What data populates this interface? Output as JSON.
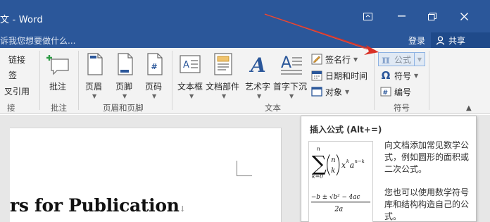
{
  "window": {
    "title": "文 - Word",
    "controls": {
      "ribbon_options": "ribbon-display-options",
      "minimize": "minimize",
      "restore": "restore",
      "close": "close"
    }
  },
  "tellme": {
    "placeholder": "诉我您想要做什么..."
  },
  "account": {
    "login": "登录",
    "share": "共享"
  },
  "ribbon": {
    "links_group": {
      "items": [
        "链接",
        "签",
        "叉引用"
      ],
      "label": "接"
    },
    "comments_group": {
      "button": "批注",
      "label": "批注"
    },
    "header_footer_group": {
      "header": "页眉",
      "footer": "页脚",
      "page_number": "页码",
      "label": "页眉和页脚"
    },
    "text_group": {
      "textbox": "文本框",
      "quick_parts": "文档部件",
      "wordart": "艺术字",
      "dropcap": "首字下沉",
      "signature_line": "签名行",
      "date_time": "日期和时间",
      "object": "对象",
      "label": "文本"
    },
    "symbols_group": {
      "equation": "公式",
      "symbol": "符号",
      "number": "编号",
      "label": "符号"
    }
  },
  "document": {
    "heading_fragment": "rs for Publication",
    "paragraph_mark": "↓"
  },
  "tooltip": {
    "title": "插入公式 (Alt+=)",
    "desc1": "向文档添加常见数学公式，例如圆形的面积或二次公式。",
    "desc2": "您也可以使用数学符号库和结构构造自己的公式。",
    "preview": {
      "sum_upper": "n",
      "sum_lower": "k=0",
      "binom_top": "n",
      "binom_bottom": "k",
      "term_x": "x",
      "exp_k": "k",
      "term_a": "a",
      "exp_nk": "n−k",
      "quad_numerator": "−b ± √b² − 4ac",
      "quad_denominator": "2a"
    }
  },
  "colors": {
    "titlebar": "#2b579a",
    "ribbon": "#f3f3f3",
    "accent_arrow": "#d93025",
    "formula_highlight": "#cfe0f4"
  }
}
